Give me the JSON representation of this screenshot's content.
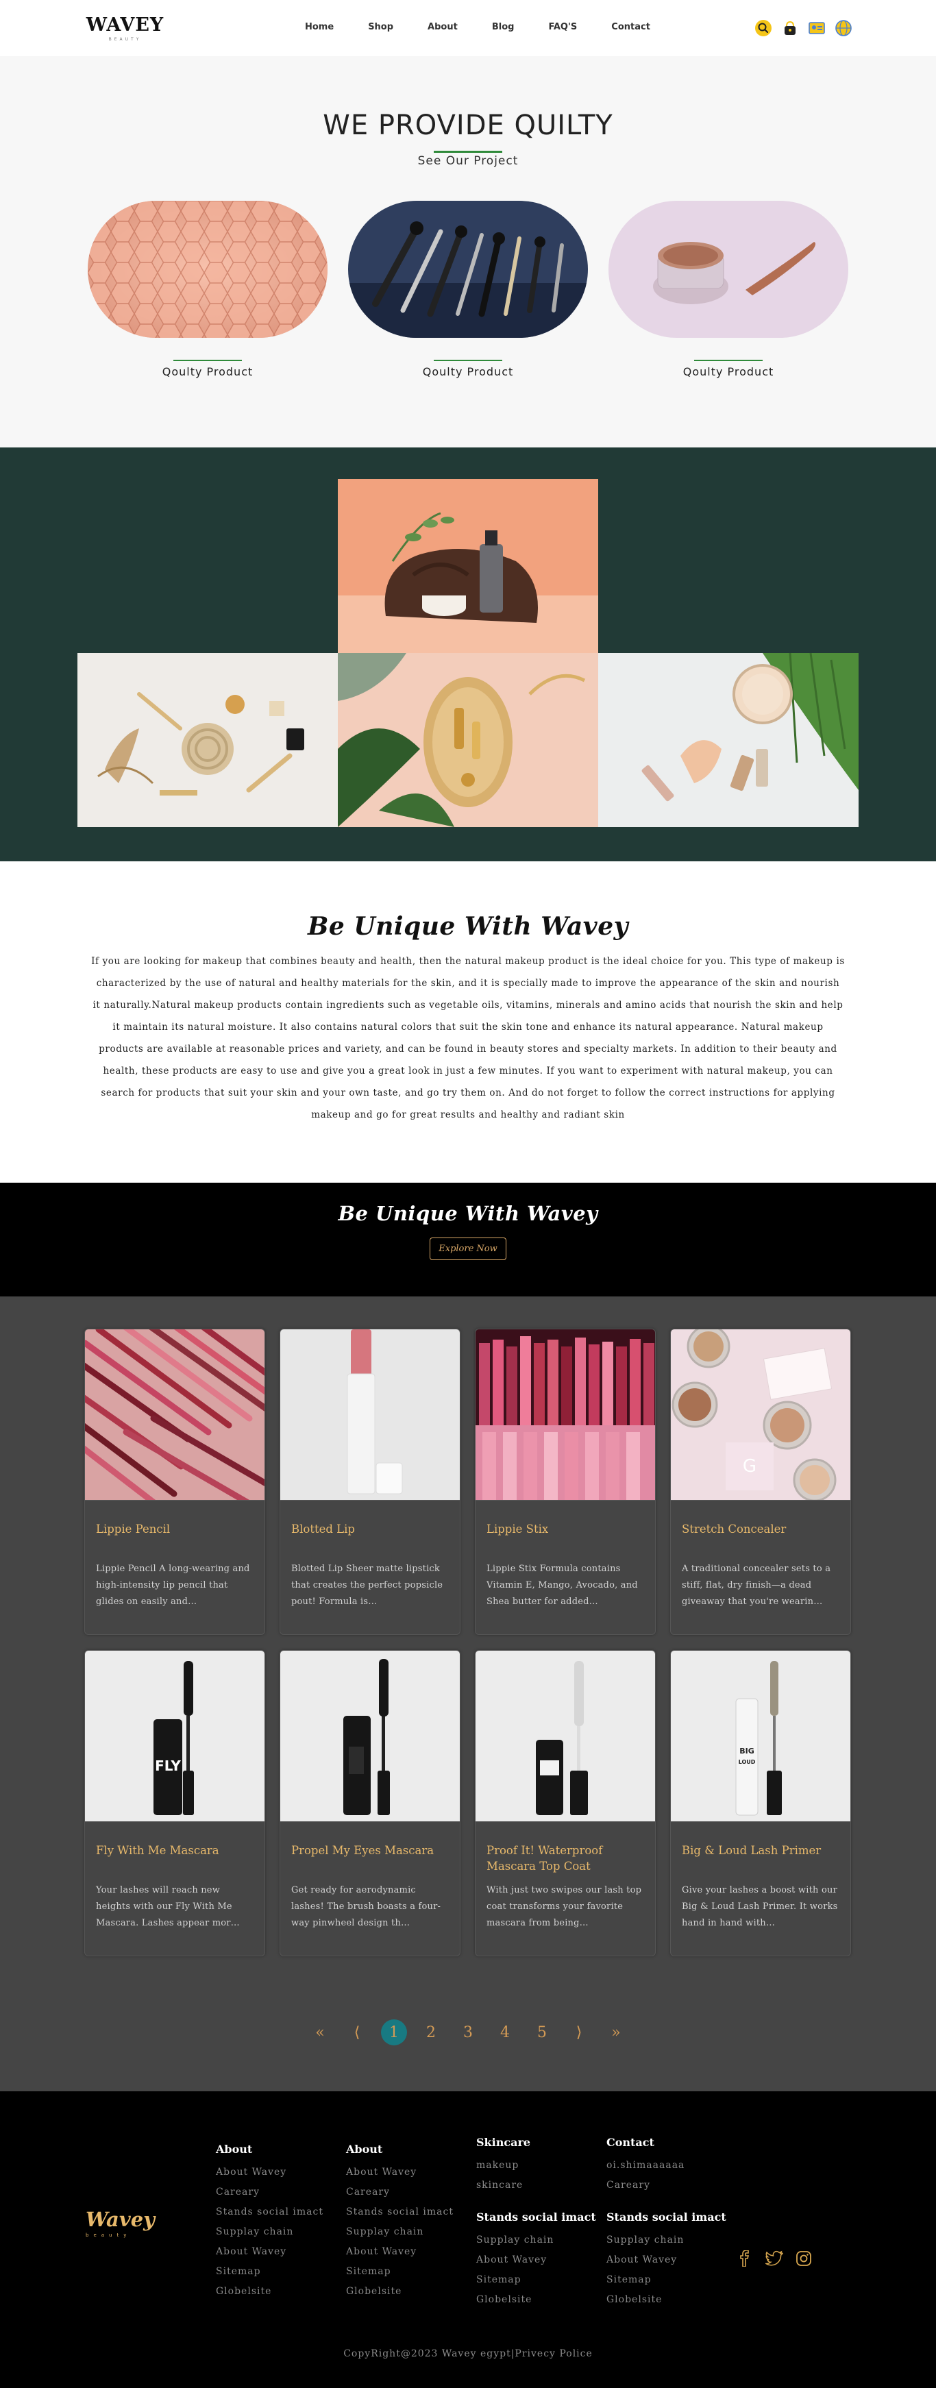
{
  "nav": {
    "logo": "WAVEY",
    "logo_sub": "BEAUTY",
    "links": [
      "Home",
      "Shop",
      "About",
      "Blog",
      "FAQ'S",
      "Contact"
    ],
    "icons": [
      "search-icon",
      "bag-icon",
      "id-card-icon",
      "language-icon"
    ],
    "accent": "#f5c518"
  },
  "quality": {
    "title": "WE PROVIDE QUILTY",
    "subtitle": "See Our Project",
    "cards": [
      {
        "label": "Qoulty Product",
        "image": "honeycomb-pattern"
      },
      {
        "label": "Qoulty Product",
        "image": "makeup-brushes"
      },
      {
        "label": "Qoulty Product",
        "image": "cream-jar"
      }
    ]
  },
  "gallery": {
    "background": "#213a36",
    "images": [
      "serum-bottle-on-wood",
      "cosmetics-flatlay",
      "gold-tray-products",
      "powder-and-nail-polish"
    ]
  },
  "unique": {
    "title": "Be Unique With Wavey",
    "body": "If you are looking for makeup that combines beauty and health, then the natural makeup product is the ideal choice for you. This type of makeup is characterized by the use of natural and healthy materials for the skin, and it is specially made to improve the appearance of the skin and nourish it naturally.Natural makeup products contain ingredients such as vegetable oils, vitamins, minerals and amino acids that nourish the skin and help it maintain its natural moisture. It also contains natural colors that suit the skin tone and enhance its natural appearance. Natural makeup products are available at reasonable prices and variety, and can be found in beauty stores and specialty markets. In addition to their beauty and health, these products are easy to use and give you a great look in just a few minutes. If you want to experiment with natural makeup, you can search for products that suit your skin and your own taste, and go try them on. And do not forget to follow the correct instructions for applying makeup and go for great results and healthy and radiant skin"
  },
  "band": {
    "title": "Be Unique With Wavey",
    "button": "Explore Now"
  },
  "products": [
    {
      "title": "Lippie Pencil",
      "desc": "Lippie Pencil A long-wearing and high-intensity lip pencil that glides on easily and…",
      "image": "lip-pencils"
    },
    {
      "title": "Blotted Lip",
      "desc": "Blotted Lip Sheer matte lipstick that creates the perfect popsicle pout! Formula is…",
      "image": "lipstick-tube"
    },
    {
      "title": "Lippie Stix",
      "desc": "Lippie Stix Formula contains Vitamin E, Mango, Avocado, and Shea butter for added…",
      "image": "lipstick-rows"
    },
    {
      "title": "Stretch Concealer",
      "desc": "A traditional concealer sets to a stiff, flat, dry finish—a dead giveaway that you're wearin…",
      "image": "concealer-pots"
    },
    {
      "title": "Fly With Me Mascara",
      "desc": "Your lashes will reach new heights with our Fly With Me Mascara. Lashes appear mor…",
      "image": "mascara-fly"
    },
    {
      "title": "Propel My Eyes Mascara",
      "desc": "Get ready for aerodynamic lashes! The brush boasts a four-way pinwheel design th…",
      "image": "mascara-propel"
    },
    {
      "title": "Proof It! Waterproof Mascara Top Coat",
      "desc": "With just two swipes our lash top coat transforms your favorite mascara from being…",
      "image": "mascara-proof"
    },
    {
      "title": "Big & Loud Lash Primer",
      "desc": "Give your lashes a boost with our Big & Loud Lash Primer. It works hand in hand with…",
      "image": "lash-primer"
    }
  ],
  "pagination": {
    "first": "«",
    "prev": "⟨",
    "pages": [
      "1",
      "2",
      "3",
      "4",
      "5"
    ],
    "current": "1",
    "next": "⟩",
    "last": "»"
  },
  "footer": {
    "logo": "Wavey",
    "logo_sub": "beauty",
    "col1": {
      "title": "About",
      "links": [
        "About Wavey",
        "Careary",
        "Stands social imact",
        "Supplay chain",
        "About Wavey",
        "Sitemap",
        "Globelsite"
      ]
    },
    "col2": {
      "title": "About",
      "links": [
        "About Wavey",
        "Careary",
        "Stands social imact",
        "Supplay chain",
        "About Wavey",
        "Sitemap",
        "Globelsite"
      ]
    },
    "col3": {
      "title": "Skincare",
      "links": [
        "makeup",
        "skincare"
      ],
      "title2": "Stands social imact",
      "links2": [
        "Supplay chain",
        "About Wavey",
        "Sitemap",
        "Globelsite"
      ]
    },
    "col4": {
      "title": "Contact",
      "links": [
        "oi.shimaaaaaa",
        "Careary"
      ],
      "title2": "Stands social imact",
      "links2": [
        "Supplay chain",
        "About Wavey",
        "Sitemap",
        "Globelsite"
      ]
    },
    "social": [
      "facebook-icon",
      "twitter-icon",
      "instagram-icon"
    ],
    "copyright": "CopyRight@2023 Wavey egypt|Privecy Police"
  }
}
